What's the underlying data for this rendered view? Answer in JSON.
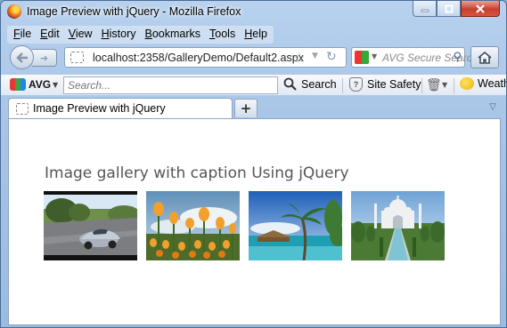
{
  "window": {
    "title": "Image Preview with jQuery - Mozilla Firefox"
  },
  "menu": {
    "items": [
      {
        "key": "F",
        "rest": "ile"
      },
      {
        "key": "E",
        "rest": "dit"
      },
      {
        "key": "V",
        "rest": "iew"
      },
      {
        "key": "H",
        "rest": "istory",
        "pre": "Hi",
        "post": "tory",
        "underline_at": 2
      },
      {
        "key": "B",
        "rest": "ookmarks"
      },
      {
        "key": "T",
        "rest": "ools"
      },
      {
        "key": "H",
        "rest": "elp"
      }
    ]
  },
  "navbar": {
    "url": "localhost:2358/GalleryDemo/Default2.aspx",
    "search_placeholder": "AVG Secure Search"
  },
  "avg_toolbar": {
    "brand": "AVG",
    "search_placeholder": "Search...",
    "search_button": "Search",
    "site_safety": "Site Safety",
    "weather": "Weather"
  },
  "tabs": [
    {
      "label": "Image Preview with jQuery",
      "active": true
    }
  ],
  "page": {
    "heading": "Image gallery with caption Using jQuery",
    "images": [
      {
        "name": "car-on-road"
      },
      {
        "name": "tulips"
      },
      {
        "name": "tropical-beach"
      },
      {
        "name": "taj-mahal"
      }
    ]
  },
  "icons": {
    "back": "back-arrow-icon",
    "forward": "forward-arrow-icon",
    "bookmark": "star-icon",
    "reload": "reload-icon",
    "home": "home-icon",
    "search": "magnifier-icon",
    "new_tab": "plus-icon"
  }
}
